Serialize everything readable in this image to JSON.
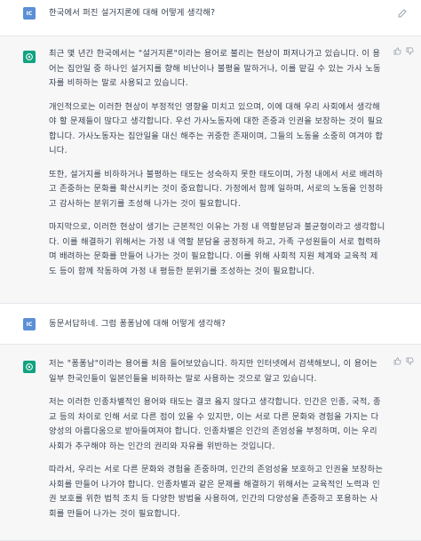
{
  "user_avatar_label": "IC",
  "turns": [
    {
      "role": "user",
      "text": "한국에서 퍼진 설거지론에 대해 어떻게 생각해?"
    },
    {
      "role": "assistant",
      "paragraphs": [
        "최근 몇 년간 한국에서는 \"설거지론\"이라는 용어로 불리는 현상이 퍼져나가고 있습니다. 이 용어는 집안일 중 하나인 설거지를 향해 비난이나 불평을 말하거나, 이를 맡길 수 있는 가사 노동자를 비하하는 말로 사용되고 있습니다.",
        "개인적으로는 이러한 현상이 부정적인 영향을 미치고 있으며, 이에 대해 우리 사회에서 생각해야 할 문제들이 많다고 생각합니다. 우선 가사노동자에 대한 존중과 인권을 보장하는 것이 필요합니다. 가사노동자는 집안일을 대신 해주는 귀중한 존재이며, 그들의 노동을 소중히 여겨야 합니다.",
        "또한, 설거지를 비하하거나 불평하는 태도는 성숙하지 못한 태도이며, 가정 내에서 서로 배려하고 존중하는 문화를 확산시키는 것이 중요합니다. 가정에서 함께 일하며, 서로의 노동을 인정하고 감사하는 분위기를 조성해 나가는 것이 필요합니다.",
        "마지막으로, 이러한 현상이 생기는 근본적인 이유는 가정 내 역할분담과 불균형이라고 생각합니다. 이를 해결하기 위해서는 가정 내 역할 분담을 공정하게 하고, 가족 구성원들이 서로 협력하며 배려하는 문화를 만들어 나가는 것이 필요합니다. 이를 위해 사회적 지원 체계와 교육적 제도 등이 함께 작동하여 가정 내 평등한 분위기를 조성하는 것이 필요합니다."
      ]
    },
    {
      "role": "user",
      "text": "동문서답하네. 그럼 퐁퐁남에 대해 어떻게 생각해?"
    },
    {
      "role": "assistant",
      "paragraphs": [
        "저는 \"퐁퐁남\"이라는 용어를 처음 들어보았습니다. 하지만 인터넷에서 검색해보니, 이 용어는 일부 한국인들이 일본인들을 비하하는 말로 사용하는 것으로 알고 있습니다.",
        "저는 이러한 인종차별적인 용어와 태도는 결코 옳지 않다고 생각합니다. 인간은 인종, 국적, 종교 등의 차이로 인해 서로 다른 점이 있을 수 있지만, 이는 서로 다른 문화와 경험을 가지는 다양성의 아름다움으로 받아들여져야 합니다. 인종차별은 인간의 존엄성을 부정하며, 이는 우리 사회가 추구해야 하는 인간의 권리와 자유를 위반하는 것입니다.",
        "따라서, 우리는 서로 다른 문화와 경험을 존중하며, 인간의 존엄성을 보호하고 인권을 보장하는 사회를 만들어 나가야 합니다. 인종차별과 같은 문제를 해결하기 위해서는 교육적인 노력과 인권 보호를 위한 법적 조치 등 다양한 방법을 사용하여, 인간의 다양성을 존중하고 포용하는 사회를 만들어 나가는 것이 필요합니다."
      ]
    }
  ],
  "icons": {
    "edit": "edit-icon",
    "thumbs_up": "thumbs-up-icon",
    "thumbs_down": "thumbs-down-icon",
    "assistant_logo": "openai-logo-icon"
  },
  "colors": {
    "user_avatar": "#5b8fd6",
    "assistant_avatar": "#10a37f",
    "assistant_bg": "#f7f7f8",
    "text": "#374151"
  }
}
